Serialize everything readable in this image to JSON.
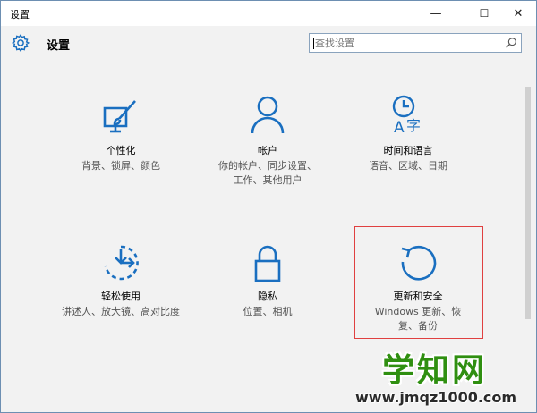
{
  "window": {
    "title": "设置",
    "controls": {
      "minimize": "—",
      "maximize": "☐",
      "close": "✕"
    }
  },
  "header": {
    "heading": "设置",
    "search": {
      "value": "",
      "placeholder": "查找设置"
    }
  },
  "tiles": [
    {
      "name": "个性化",
      "desc": "背景、锁屏、颜色",
      "icon": "personalization-icon"
    },
    {
      "name": "帐户",
      "desc": "你的帐户、同步设置、工作、其他用户",
      "icon": "account-icon"
    },
    {
      "name": "时间和语言",
      "desc": "语音、区域、日期",
      "icon": "time-language-icon"
    },
    {
      "name": "轻松使用",
      "desc": "讲述人、放大镜、高对比度",
      "icon": "ease-of-access-icon"
    },
    {
      "name": "隐私",
      "desc": "位置、相机",
      "icon": "privacy-lock-icon"
    },
    {
      "name": "更新和安全",
      "desc": "Windows 更新、恢复、备份",
      "icon": "update-refresh-icon"
    }
  ],
  "colors": {
    "accent": "#1a6fc0",
    "highlight_border": "#e04040",
    "watermark_green": "#2f8f10"
  },
  "watermark": {
    "brand": "学知网",
    "url": "www.jmqz1000.com"
  }
}
